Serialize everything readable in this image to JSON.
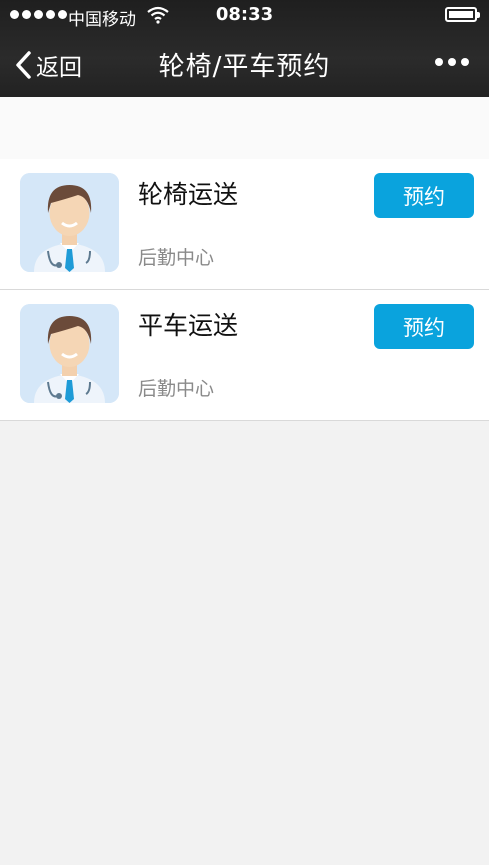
{
  "status_bar": {
    "carrier": "中国移动",
    "time": "08:33"
  },
  "nav": {
    "back_label": "返回",
    "title": "轮椅/平车预约"
  },
  "items": [
    {
      "name": "轮椅运送",
      "department": "后勤中心",
      "button": "预约"
    },
    {
      "name": "平车运送",
      "department": "后勤中心",
      "button": "预约"
    }
  ],
  "colors": {
    "accent": "#0aa3dd",
    "navbar": "#222222",
    "background": "#f2f2f2"
  }
}
